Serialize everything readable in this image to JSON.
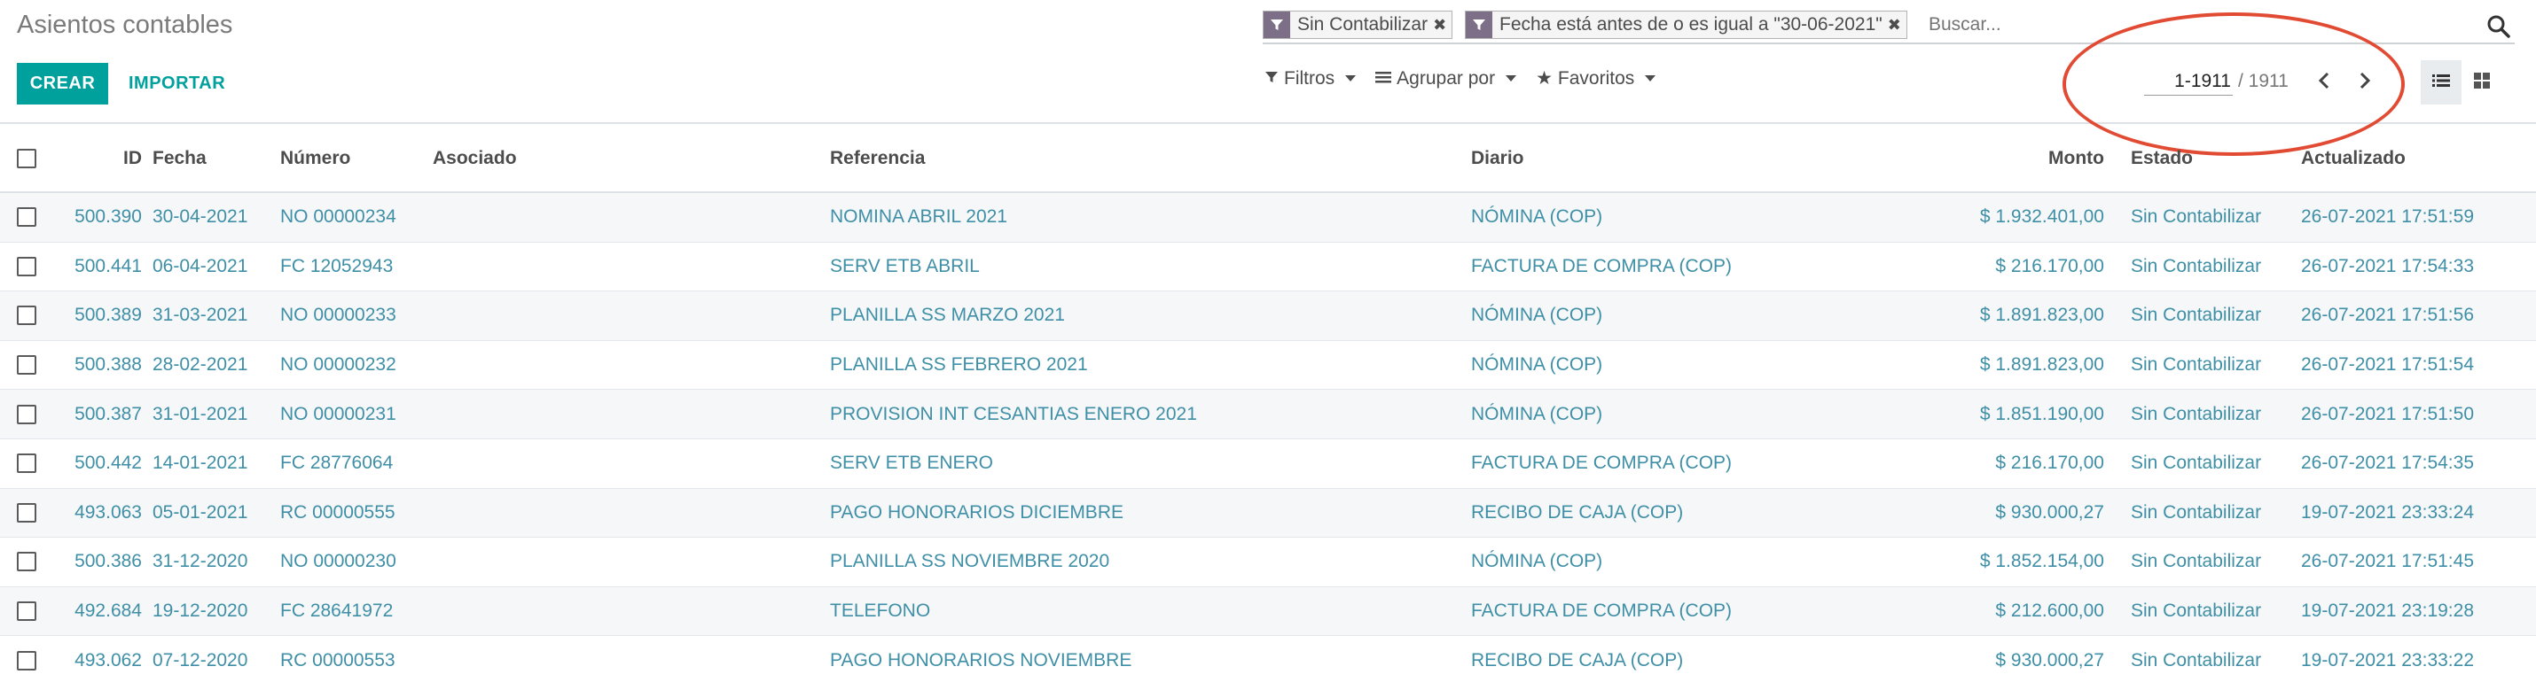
{
  "page": {
    "title": "Asientos contables"
  },
  "actions": {
    "create": "CREAR",
    "import": "IMPORTAR"
  },
  "search": {
    "facets": [
      {
        "label": "Sin Contabilizar"
      },
      {
        "label": "Fecha está antes de o es igual a \"30-06-2021\""
      }
    ],
    "placeholder": "Buscar..."
  },
  "filters": {
    "filters_label": "Filtros",
    "group_label": "Agrupar por",
    "favorites_label": "Favoritos"
  },
  "pager": {
    "range": "1-1911",
    "total": "/ 1911"
  },
  "colors": {
    "accent": "#00a09d",
    "link": "#3f8fa7",
    "facet_icon": "#7c6f87",
    "annotation": "#e24b33"
  },
  "table": {
    "headers": {
      "id": "ID",
      "fecha": "Fecha",
      "numero": "Número",
      "asociado": "Asociado",
      "referencia": "Referencia",
      "diario": "Diario",
      "monto": "Monto",
      "estado": "Estado",
      "actualizado": "Actualizado"
    },
    "rows": [
      {
        "id": "500.390",
        "fecha": "30-04-2021",
        "numero": "NO 00000234",
        "asociado": "",
        "referencia": "NOMINA ABRIL 2021",
        "diario": "NÓMINA (COP)",
        "monto": "$ 1.932.401,00",
        "estado": "Sin Contabilizar",
        "actualizado": "26-07-2021 17:51:59"
      },
      {
        "id": "500.441",
        "fecha": "06-04-2021",
        "numero": "FC 12052943",
        "asociado": "",
        "referencia": "SERV ETB ABRIL",
        "diario": "FACTURA DE COMPRA (COP)",
        "monto": "$ 216.170,00",
        "estado": "Sin Contabilizar",
        "actualizado": "26-07-2021 17:54:33"
      },
      {
        "id": "500.389",
        "fecha": "31-03-2021",
        "numero": "NO 00000233",
        "asociado": "",
        "referencia": "PLANILLA SS MARZO 2021",
        "diario": "NÓMINA (COP)",
        "monto": "$ 1.891.823,00",
        "estado": "Sin Contabilizar",
        "actualizado": "26-07-2021 17:51:56"
      },
      {
        "id": "500.388",
        "fecha": "28-02-2021",
        "numero": "NO 00000232",
        "asociado": "",
        "referencia": "PLANILLA SS FEBRERO 2021",
        "diario": "NÓMINA (COP)",
        "monto": "$ 1.891.823,00",
        "estado": "Sin Contabilizar",
        "actualizado": "26-07-2021 17:51:54"
      },
      {
        "id": "500.387",
        "fecha": "31-01-2021",
        "numero": "NO 00000231",
        "asociado": "",
        "referencia": "PROVISION INT CESANTIAS ENERO 2021",
        "diario": "NÓMINA (COP)",
        "monto": "$ 1.851.190,00",
        "estado": "Sin Contabilizar",
        "actualizado": "26-07-2021 17:51:50"
      },
      {
        "id": "500.442",
        "fecha": "14-01-2021",
        "numero": "FC 28776064",
        "asociado": "",
        "referencia": "SERV ETB ENERO",
        "diario": "FACTURA DE COMPRA (COP)",
        "monto": "$ 216.170,00",
        "estado": "Sin Contabilizar",
        "actualizado": "26-07-2021 17:54:35"
      },
      {
        "id": "493.063",
        "fecha": "05-01-2021",
        "numero": "RC 00000555",
        "asociado": "",
        "referencia": "PAGO HONORARIOS DICIEMBRE",
        "diario": "RECIBO DE CAJA (COP)",
        "monto": "$ 930.000,27",
        "estado": "Sin Contabilizar",
        "actualizado": "19-07-2021 23:33:24"
      },
      {
        "id": "500.386",
        "fecha": "31-12-2020",
        "numero": "NO 00000230",
        "asociado": "",
        "referencia": "PLANILLA SS NOVIEMBRE 2020",
        "diario": "NÓMINA (COP)",
        "monto": "$ 1.852.154,00",
        "estado": "Sin Contabilizar",
        "actualizado": "26-07-2021 17:51:45"
      },
      {
        "id": "492.684",
        "fecha": "19-12-2020",
        "numero": "FC 28641972",
        "asociado": "",
        "referencia": "TELEFONO",
        "diario": "FACTURA DE COMPRA (COP)",
        "monto": "$ 212.600,00",
        "estado": "Sin Contabilizar",
        "actualizado": "19-07-2021 23:19:28"
      },
      {
        "id": "493.062",
        "fecha": "07-12-2020",
        "numero": "RC 00000553",
        "asociado": "",
        "referencia": "PAGO HONORARIOS NOVIEMBRE",
        "diario": "RECIBO DE CAJA (COP)",
        "monto": "$ 930.000,27",
        "estado": "Sin Contabilizar",
        "actualizado": "19-07-2021 23:33:22"
      }
    ]
  }
}
